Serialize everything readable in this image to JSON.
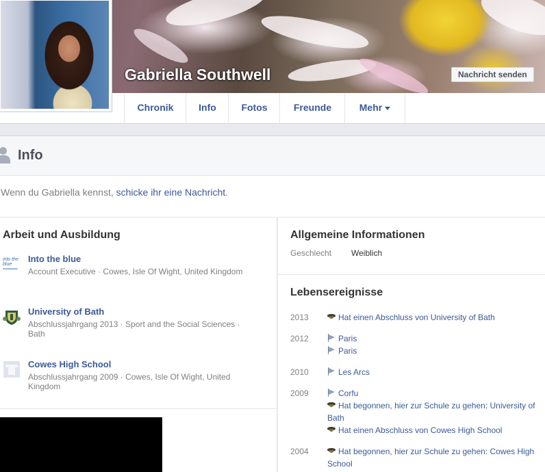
{
  "profile": {
    "name": "Gabriella Southwell",
    "message_button": "Nachricht senden"
  },
  "tabs": [
    {
      "label": "Chronik"
    },
    {
      "label": "Info"
    },
    {
      "label": "Fotos"
    },
    {
      "label": "Freunde"
    },
    {
      "label": "Mehr"
    }
  ],
  "info": {
    "title": "Info",
    "intro_prefix": "Wenn du Gabriella kennst, ",
    "intro_link": "schicke ihr eine Nachricht",
    "intro_suffix": "."
  },
  "work_education": {
    "title": "Arbeit und Ausbildung",
    "items": [
      {
        "name": "Into the blue",
        "detail": "Account Executive · Cowes, Isle Of Wight, United Kingdom",
        "logo": "into-the-blue-logo",
        "logo_text": "into the blue"
      },
      {
        "name": "University of Bath",
        "detail": "Abschlussjahrgang 2013 · Sport and the Social Sciences · Bath",
        "logo": "university-crest-icon"
      },
      {
        "name": "Cowes High School",
        "detail": "Abschlussjahrgang 2009 · Cowes, Isle Of Wight, United Kingdom",
        "logo": "school-placeholder-icon"
      }
    ]
  },
  "general_info": {
    "title": "Allgemeine Informationen",
    "gender_label": "Geschlecht",
    "gender_value": "Weiblich"
  },
  "life_events": {
    "title": "Lebensereignisse",
    "years": [
      {
        "year": "2013",
        "events": [
          {
            "icon": "graduation-cap-icon",
            "text": "Hat einen Abschluss von University of Bath"
          }
        ]
      },
      {
        "year": "2012",
        "events": [
          {
            "icon": "flag-icon",
            "text": "Paris"
          },
          {
            "icon": "flag-icon",
            "text": "Paris"
          }
        ]
      },
      {
        "year": "2010",
        "events": [
          {
            "icon": "flag-icon",
            "text": "Les Arcs"
          }
        ]
      },
      {
        "year": "2009",
        "events": [
          {
            "icon": "flag-icon",
            "text": "Corfu"
          },
          {
            "icon": "graduation-cap-icon",
            "text": "Hat begonnen, hier zur Schule zu gehen: University of Bath"
          },
          {
            "icon": "graduation-cap-icon",
            "text": "Hat einen Abschluss von Cowes High School"
          }
        ]
      },
      {
        "year": "2004",
        "events": [
          {
            "icon": "graduation-cap-icon",
            "text": "Hat begonnen, hier zur Schule zu gehen: Cowes High School"
          }
        ]
      }
    ]
  },
  "colors": {
    "link": "#3b5998",
    "muted": "#7f7f7f",
    "background": "#e9eaed"
  }
}
